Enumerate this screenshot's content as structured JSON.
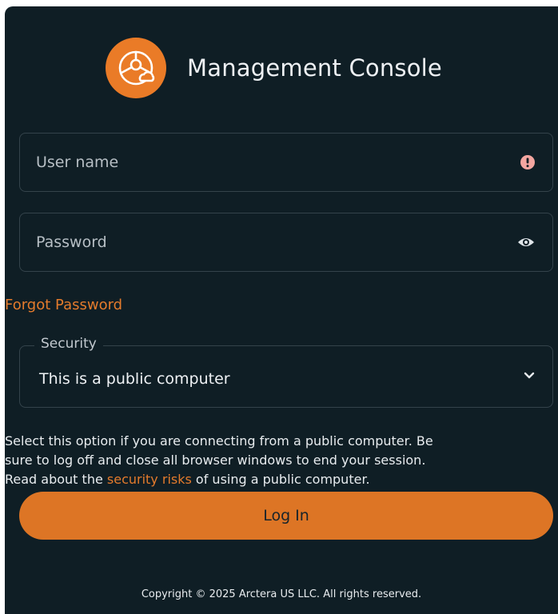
{
  "header": {
    "title": "Management Console",
    "logo_icon": "globe-cloud-logo",
    "logo_color": "#ea7b27"
  },
  "login_form": {
    "username": {
      "placeholder": "User name",
      "value": "",
      "status_icon": "error-exclamation-icon"
    },
    "password": {
      "placeholder": "Password",
      "value": "",
      "toggle_icon": "eye-icon"
    },
    "forgot_password_link": "Forgot Password",
    "security": {
      "label": "Security",
      "selected": "This is a public computer",
      "dropdown_icon": "chevron-down-icon"
    },
    "help_text": {
      "line1": "Select this option if you are connecting from a public computer. Be",
      "line2": "sure to log off and close all browser windows to end your session.",
      "line3_prefix": "Read about the",
      "line3_link": "security risks",
      "line3_suffix": "of using a public computer."
    },
    "login_button": "Log In"
  },
  "footer": {
    "copyright": "Copyright © 2025 Arctera US LLC. All rights reserved."
  },
  "colors": {
    "background": "#0f1e25",
    "accent": "#e47b2c",
    "button": "#dd7525",
    "error": "#f3a6a0"
  }
}
